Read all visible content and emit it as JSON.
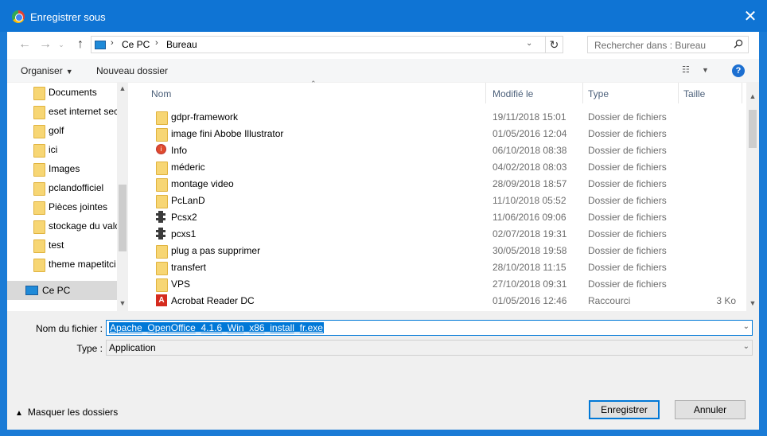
{
  "title": "Enregistrer sous",
  "close_glyph": "✕",
  "nav": {
    "back_glyph": "←",
    "forward_glyph": "→",
    "up_glyph": "↑",
    "crumbs": [
      "Ce PC",
      "Bureau"
    ],
    "sep_glyph": "›",
    "refresh_glyph": "↻",
    "search_placeholder": "Rechercher dans : Bureau"
  },
  "toolbar": {
    "organize": "Organiser",
    "new_folder": "Nouveau dossier",
    "help": "?"
  },
  "sidebar": {
    "items": [
      {
        "label": "Documents"
      },
      {
        "label": "eset internet sec"
      },
      {
        "label": "golf"
      },
      {
        "label": "ici"
      },
      {
        "label": "Images"
      },
      {
        "label": "pclandofficiel"
      },
      {
        "label": "Pièces jointes"
      },
      {
        "label": "stockage du valc"
      },
      {
        "label": "test"
      },
      {
        "label": "theme mapetitci"
      }
    ],
    "selected": "Ce PC"
  },
  "columns": {
    "name": "Nom",
    "modified": "Modifié le",
    "type": "Type",
    "size": "Taille"
  },
  "files": [
    {
      "name": "gdpr-framework",
      "date": "19/11/2018 15:01",
      "type": "Dossier de fichiers",
      "size": "",
      "icon": "folder-icon"
    },
    {
      "name": "image fini Abobe Illustrator",
      "date": "01/05/2016 12:04",
      "type": "Dossier de fichiers",
      "size": "",
      "icon": "folder-icon"
    },
    {
      "name": "Info",
      "date": "06/10/2018 08:38",
      "type": "Dossier de fichiers",
      "size": "",
      "icon": "info-folder-icon"
    },
    {
      "name": "méderic",
      "date": "04/02/2018 08:03",
      "type": "Dossier de fichiers",
      "size": "",
      "icon": "folder-icon"
    },
    {
      "name": "montage video",
      "date": "28/09/2018 18:57",
      "type": "Dossier de fichiers",
      "size": "",
      "icon": "folder-icon"
    },
    {
      "name": "PcLanD",
      "date": "11/10/2018 05:52",
      "type": "Dossier de fichiers",
      "size": "",
      "icon": "folder-icon"
    },
    {
      "name": "Pcsx2",
      "date": "11/06/2016 09:06",
      "type": "Dossier de fichiers",
      "size": "",
      "icon": "film-folder-icon"
    },
    {
      "name": "pcxs1",
      "date": "02/07/2018 19:31",
      "type": "Dossier de fichiers",
      "size": "",
      "icon": "film-folder-icon"
    },
    {
      "name": "plug a pas supprimer",
      "date": "30/05/2018 19:58",
      "type": "Dossier de fichiers",
      "size": "",
      "icon": "folder-icon"
    },
    {
      "name": "transfert",
      "date": "28/10/2018 11:15",
      "type": "Dossier de fichiers",
      "size": "",
      "icon": "folder-icon"
    },
    {
      "name": "VPS",
      "date": "27/10/2018 09:31",
      "type": "Dossier de fichiers",
      "size": "",
      "icon": "folder-icon"
    },
    {
      "name": "Acrobat Reader DC",
      "date": "01/05/2016 12:46",
      "type": "Raccourci",
      "size": "3 Ko",
      "icon": "acrobat-shortcut-icon"
    }
  ],
  "filename": {
    "label": "Nom du fichier :",
    "value": "Apache_OpenOffice_4.1.6_Win_x86_install_fr.exe"
  },
  "filetype": {
    "label": "Type :",
    "value": "Application"
  },
  "footer": {
    "hide_folders": "Masquer les dossiers",
    "save": "Enregistrer",
    "cancel": "Annuler"
  }
}
